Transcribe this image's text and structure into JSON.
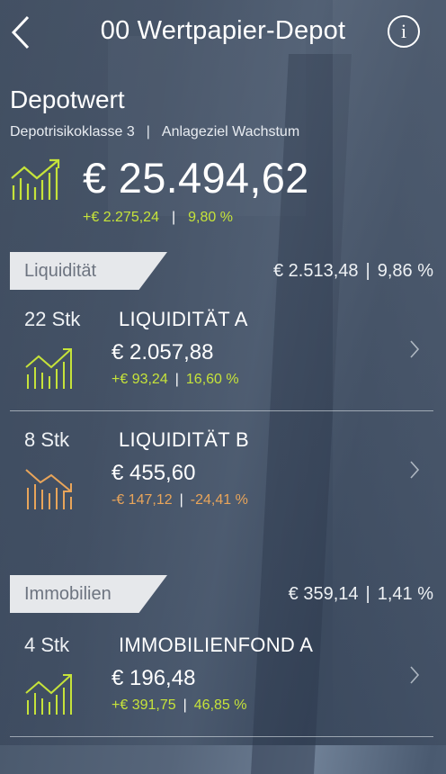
{
  "header": {
    "title": "00 Wertpapier-Depot",
    "info_glyph": "i"
  },
  "depot": {
    "title": "Depotwert",
    "risk_class": "Depotrisikoklasse 3",
    "separator": "|",
    "goal": "Anlageziel Wachstum",
    "value": "€ 25.494,62",
    "change_abs": "+€ 2.275,24",
    "change_pct": "9,80 %",
    "trend": "up"
  },
  "categories": [
    {
      "name": "Liquidität",
      "sum": "€ 2.513,48",
      "pct": "9,86 %",
      "positions": [
        {
          "qty": "22 Stk",
          "name": "LIQUIDITÄT A",
          "value": "€ 2.057,88",
          "change_abs": "+€ 93,24",
          "change_pct": "16,60 %",
          "trend": "up"
        },
        {
          "qty": "8 Stk",
          "name": "LIQUIDITÄT B",
          "value": "€ 455,60",
          "change_abs": "-€ 147,12",
          "change_pct": "-24,41 %",
          "trend": "down"
        }
      ]
    },
    {
      "name": "Immobilien",
      "sum": "€ 359,14",
      "pct": "1,41 %",
      "positions": [
        {
          "qty": "4 Stk",
          "name": "IMMOBILIENFOND A",
          "value": "€ 196,48",
          "change_abs": "+€ 391,75",
          "change_pct": "46,85 %",
          "trend": "up"
        }
      ]
    }
  ],
  "colors": {
    "positive": "#c6e33a",
    "negative": "#e9a55a",
    "tag_bg": "#e6e8eb",
    "tag_text": "#6d7480"
  },
  "icons": {
    "back": "chevron-left-icon",
    "info": "info-icon",
    "trend_up": "trend-up-chart-icon",
    "trend_down": "trend-down-chart-icon",
    "row_chevron": "chevron-right-icon"
  }
}
